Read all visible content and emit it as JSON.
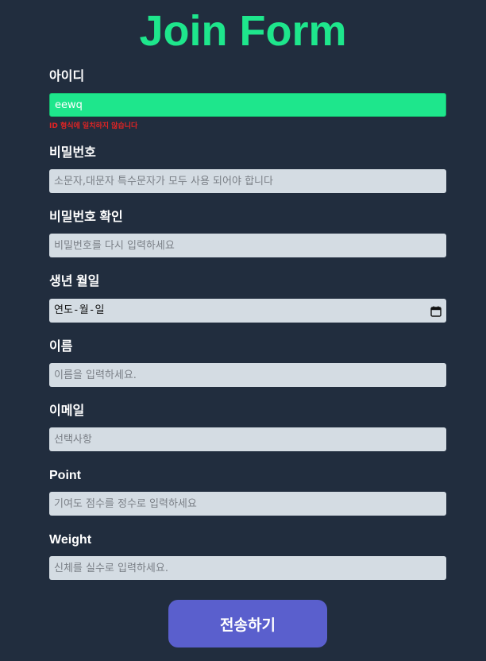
{
  "form": {
    "title": "Join Form",
    "id": {
      "label": "아이디",
      "value": "eewq",
      "error": "ID 형식에 일치하지 않습니다"
    },
    "password": {
      "label": "비밀번호",
      "placeholder": "소문자,대문자 특수문자가 모두 사용 되어야 합니다"
    },
    "password_confirm": {
      "label": "비밀번호 확인",
      "placeholder": "비밀번호를 다시 입력하세요"
    },
    "birthdate": {
      "label": "생년 월일",
      "placeholder": "연도-월-일"
    },
    "name": {
      "label": "이름",
      "placeholder": "이름을 입력하세요."
    },
    "email": {
      "label": "이메일",
      "placeholder": "선택사항"
    },
    "point": {
      "label": "Point",
      "placeholder": "기여도 점수를 정수로 입력하세요"
    },
    "weight": {
      "label": "Weight",
      "placeholder": "신체를 실수로 입력하세요."
    },
    "submit_label": "전송하기"
  },
  "colors": {
    "background": "#212d3e",
    "accent": "#1ee68c",
    "error": "#e02424",
    "input_bg": "#d4dce3",
    "button_bg": "#5a5fcd"
  },
  "icons": {
    "date_picker": "calendar-icon"
  }
}
